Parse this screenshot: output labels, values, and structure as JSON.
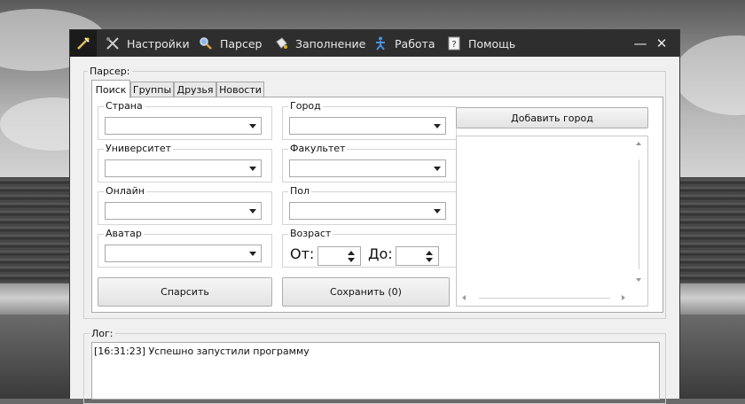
{
  "menu": {
    "items": [
      {
        "label": "Настройки",
        "icon": "tools-icon"
      },
      {
        "label": "Парсер",
        "icon": "magnifier-icon"
      },
      {
        "label": "Заполнение",
        "icon": "bucket-icon"
      },
      {
        "label": "Работа",
        "icon": "running-man-icon"
      },
      {
        "label": "Помощь",
        "icon": "help-icon"
      }
    ],
    "minimize": "—",
    "close": "✕"
  },
  "parser": {
    "title": "Парсер:",
    "tabs": [
      "Поиск",
      "Группы",
      "Друзья",
      "Новости"
    ],
    "fields": {
      "country": "Страна",
      "city": "Город",
      "university": "Университет",
      "faculty": "Факультет",
      "online": "Онлайн",
      "gender": "Пол",
      "avatar": "Аватар",
      "age": "Возраст"
    },
    "age_from": "От:",
    "age_to": "До:",
    "add_city": "Добавить город",
    "parse": "Спарсить",
    "save": "Сохранить (0)"
  },
  "log": {
    "title": "Лог:",
    "lines": [
      "[16:31:23] Успешно запустили программу"
    ]
  },
  "colors": {
    "titlebar": "#2e2e2e",
    "window_bg": "#f0f0f0",
    "panel_bg": "#ffffff"
  }
}
